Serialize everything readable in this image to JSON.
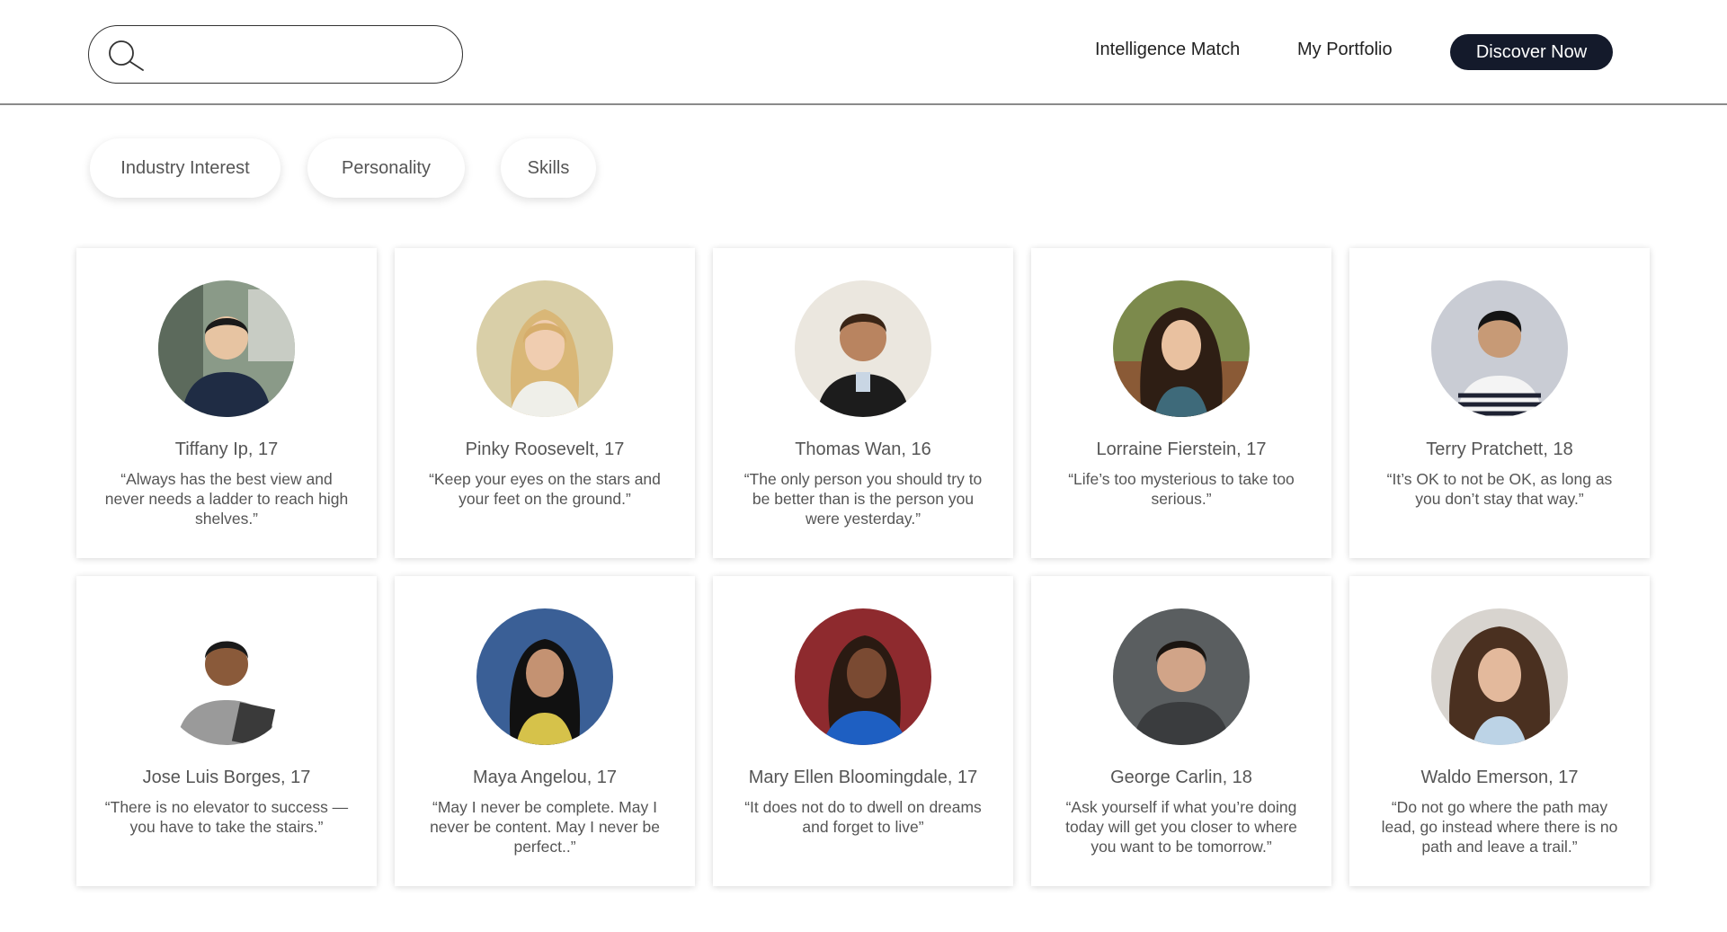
{
  "search": {
    "placeholder": ""
  },
  "nav": {
    "intelligence_match": "Intelligence Match",
    "my_portfolio": "My Portfolio",
    "discover_now": "Discover Now"
  },
  "filters": [
    "Industry Interest",
    "Personality",
    "Skills"
  ],
  "colors": {
    "primary_button": "#141a2b",
    "text": "#555555",
    "divider": "#8a8a8a"
  },
  "profiles": [
    {
      "name": "Tiffany Ip, 17",
      "quote": "“Always has the best view and never needs a ladder to reach high shelves.”"
    },
    {
      "name": "Pinky Roosevelt, 17",
      "quote": "“Keep your eyes on the stars and your feet on the ground.”"
    },
    {
      "name": "Thomas Wan, 16",
      "quote": "“The only person you should try to be better than is the person you were yesterday.”"
    },
    {
      "name": "Lorraine Fierstein, 17",
      "quote": "“Life’s too mysterious to take too serious.”"
    },
    {
      "name": "Terry Pratchett, 18",
      "quote": "“It’s OK to not be OK, as long as you don’t stay that way.”"
    },
    {
      "name": "Jose Luis Borges, 17",
      "quote": "“There is no elevator to success — you have to take the stairs.”"
    },
    {
      "name": "Maya Angelou, 17",
      "quote": "“May I never be complete. May I never be content. May I never be perfect..”"
    },
    {
      "name": "Mary Ellen Bloomingdale, 17",
      "quote": "“It does not do to dwell on dreams and forget to live”"
    },
    {
      "name": "George Carlin, 18",
      "quote": "“Ask yourself if what you’re doing today will get you closer to where you want to be tomorrow.”"
    },
    {
      "name": "Waldo Emerson, 17",
      "quote": "“Do not go where the path may lead, go instead where there is no path and leave a trail.”"
    }
  ]
}
